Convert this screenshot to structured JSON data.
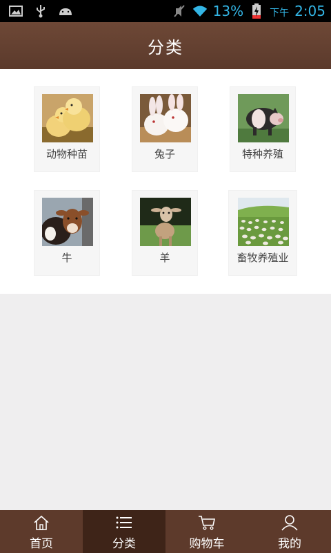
{
  "status_bar": {
    "battery_percent": "13%",
    "ampm": "下午",
    "time": "2:05",
    "color": "#33b5e5"
  },
  "header": {
    "title": "分类"
  },
  "categories": [
    {
      "label": "动物种苗",
      "image": "chicks-photo"
    },
    {
      "label": "兔子",
      "image": "rabbits-photo"
    },
    {
      "label": "特种养殖",
      "image": "pig-photo"
    },
    {
      "label": "牛",
      "image": "cow-photo"
    },
    {
      "label": "羊",
      "image": "goat-photo"
    },
    {
      "label": "畜牧养殖业",
      "image": "sheep-pasture-photo"
    }
  ],
  "bottom_nav": {
    "items": [
      {
        "label": "首页",
        "icon": "home-icon",
        "active": false
      },
      {
        "label": "分类",
        "icon": "list-icon",
        "active": true
      },
      {
        "label": "购物车",
        "icon": "cart-icon",
        "active": false
      },
      {
        "label": "我的",
        "icon": "user-icon",
        "active": false
      }
    ]
  },
  "colors": {
    "brand_brown": "#5d3a2b",
    "active_tab": "#3e2418"
  }
}
